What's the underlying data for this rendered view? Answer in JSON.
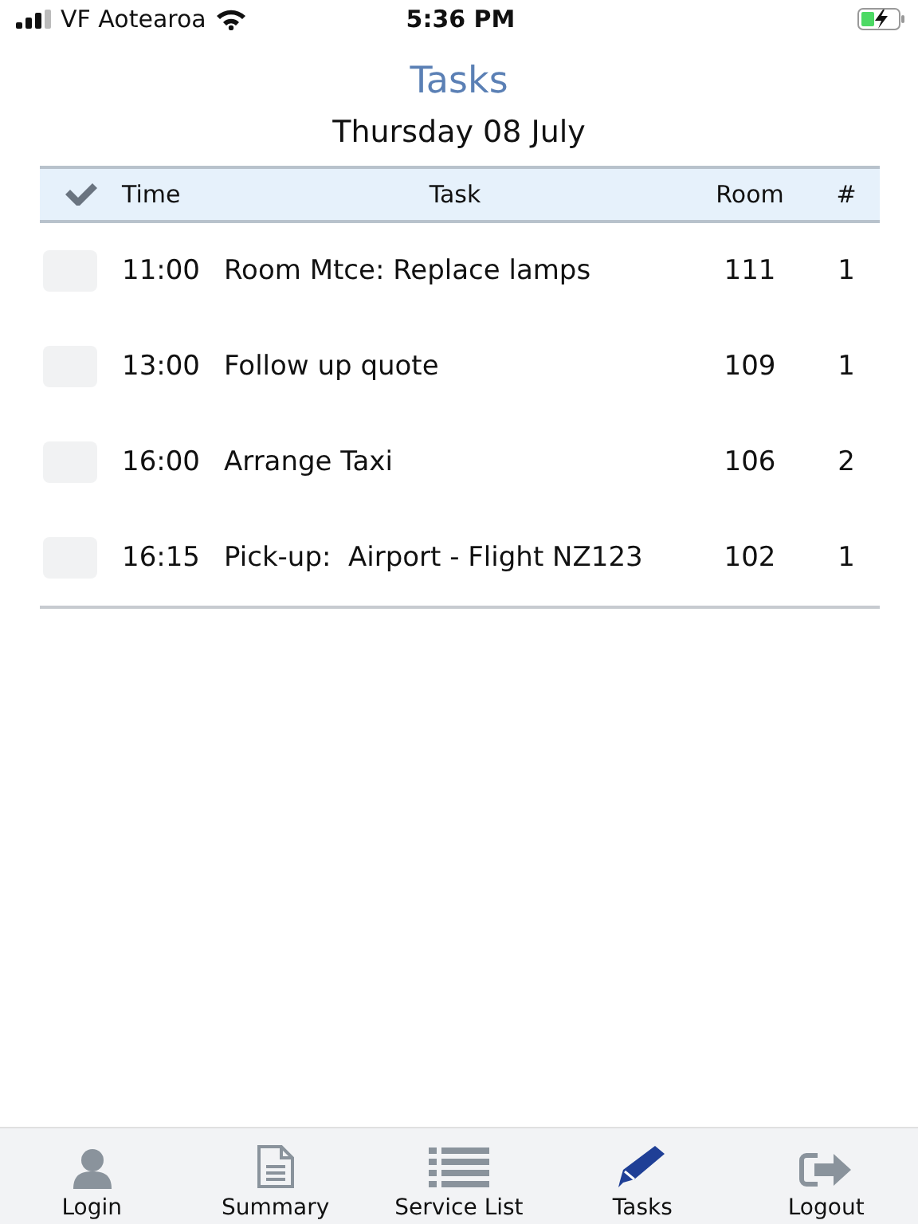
{
  "status_bar": {
    "carrier": "VF Aotearoa",
    "time": "5:36 PM"
  },
  "title": "Tasks",
  "date": "Thursday 08 July",
  "table": {
    "columns": [
      "Time",
      "Task",
      "Room",
      "#"
    ],
    "rows": [
      {
        "checked": false,
        "time": "11:00",
        "task": "Room Mtce: Replace lamps",
        "room": "111",
        "count": "1"
      },
      {
        "checked": false,
        "time": "13:00",
        "task": "Follow up quote",
        "room": "109",
        "count": "1"
      },
      {
        "checked": false,
        "time": "16:00",
        "task": "Arrange Taxi",
        "room": "106",
        "count": "2"
      },
      {
        "checked": false,
        "time": "16:15",
        "task": "Pick-up:  Airport - Flight NZ123",
        "room": "102",
        "count": "1"
      }
    ]
  },
  "tabs": [
    {
      "label": "Login",
      "kind": "person",
      "selected": false
    },
    {
      "label": "Summary",
      "kind": "document",
      "selected": false
    },
    {
      "label": "Service List",
      "kind": "list",
      "selected": false
    },
    {
      "label": "Tasks",
      "kind": "pencil",
      "selected": true
    },
    {
      "label": "Logout",
      "kind": "exit",
      "selected": false
    }
  ]
}
